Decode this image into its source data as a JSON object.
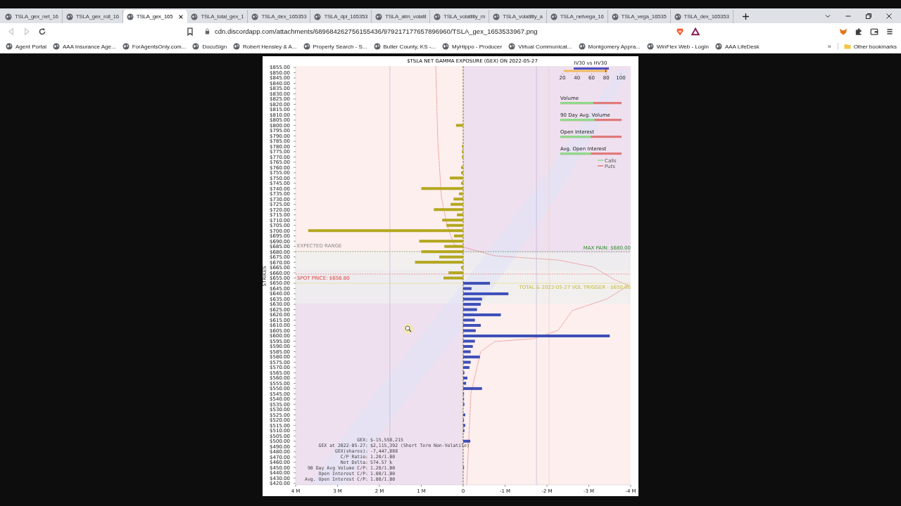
{
  "browser": {
    "tabs": [
      {
        "title": "TSLA_gex_net_16",
        "selected": false
      },
      {
        "title": "TSLA_gex_roll_16",
        "selected": false
      },
      {
        "title": "TSLA_gex_165",
        "selected": true
      },
      {
        "title": "TSLA_total_gex_1",
        "selected": false
      },
      {
        "title": "TSLA_dex_165353",
        "selected": false
      },
      {
        "title": "TSLA_dpi_165353",
        "selected": false
      },
      {
        "title": "TSLA_atm_volatil",
        "selected": false
      },
      {
        "title": "TSLA_volatility_m",
        "selected": false
      },
      {
        "title": "TSLA_volatility_a",
        "selected": false
      },
      {
        "title": "TSLA_netvega_16",
        "selected": false
      },
      {
        "title": "TSLA_vega_16535",
        "selected": false
      },
      {
        "title": "TSLA_dex_165353",
        "selected": false
      }
    ],
    "address": "cdn.discordapp.com/attachments/689684262756155436/979217177657896960/TSLA_gex_1653533967.png",
    "bookmarks": [
      "Agent Portal",
      "AAA Insurance Age...",
      "ForAgentsOnly.com...",
      "DocuSign",
      "Robert Hensley & A...",
      "Property Search - S...",
      "Butler County, KS -...",
      "MyHippo - Producer",
      "Virtual Communicat...",
      "Montgomery Appra...",
      "WinFlex Web - Login",
      "AAA LifeDesk"
    ],
    "bookmarks_more": "»",
    "other_bookmarks": "Other bookmarks"
  },
  "image": {
    "chart_data": {
      "type": "bar",
      "orientation": "horizontal",
      "title": "$TSLA NET GAMMA EXPOSURE (GEX) ON 2022-05-27",
      "ylabel": "STRIKES",
      "categories": [
        "$855.00",
        "$850.00",
        "$845.00",
        "$840.00",
        "$835.00",
        "$830.00",
        "$825.00",
        "$820.00",
        "$815.00",
        "$810.00",
        "$805.00",
        "$800.00",
        "$795.00",
        "$790.00",
        "$785.00",
        "$780.00",
        "$775.00",
        "$770.00",
        "$765.00",
        "$760.00",
        "$755.00",
        "$750.00",
        "$745.00",
        "$740.00",
        "$735.00",
        "$730.00",
        "$725.00",
        "$720.00",
        "$715.00",
        "$710.00",
        "$705.00",
        "$700.00",
        "$695.00",
        "$690.00",
        "$685.00",
        "$680.00",
        "$675.00",
        "$670.00",
        "$665.00",
        "$660.00",
        "$655.00",
        "$650.00",
        "$645.00",
        "$640.00",
        "$635.00",
        "$630.00",
        "$625.00",
        "$620.00",
        "$615.00",
        "$610.00",
        "$605.00",
        "$600.00",
        "$595.00",
        "$590.00",
        "$585.00",
        "$580.00",
        "$575.00",
        "$570.00",
        "$565.00",
        "$560.00",
        "$555.00",
        "$550.00",
        "$545.00",
        "$540.00",
        "$535.00",
        "$530.00",
        "$525.00",
        "$520.00",
        "$515.00",
        "$510.00",
        "$505.00",
        "$500.00",
        "$490.00",
        "$480.00",
        "$470.00",
        "$460.00",
        "$450.00",
        "$440.00",
        "$430.00",
        "$420.00"
      ],
      "values": [
        0,
        0,
        0,
        0,
        0,
        0,
        0,
        0,
        0,
        0,
        0,
        0.17,
        0,
        0,
        0,
        0.03,
        0.03,
        0.03,
        0,
        0.05,
        0.05,
        0.32,
        0.05,
        1.0,
        0.1,
        0.23,
        0.3,
        0.7,
        0.15,
        0.5,
        0.4,
        3.7,
        0.22,
        1.05,
        0.45,
        1.0,
        0.57,
        1.15,
        0.05,
        0.35,
        0.47,
        -0.64,
        -0.2,
        -1.08,
        -0.45,
        -0.42,
        -0.33,
        -0.9,
        -0.28,
        -0.42,
        -0.3,
        -3.5,
        -0.28,
        -0.23,
        -0.18,
        -0.4,
        -0.18,
        -0.15,
        -0.03,
        -0.1,
        -0.07,
        -0.45,
        -0.02,
        -0.02,
        -0.03,
        0,
        -0.05,
        -0.02,
        -0.05,
        -0.03,
        0,
        -0.17,
        0,
        0,
        0,
        0,
        -0.02,
        0,
        0,
        0
      ],
      "xlim": [
        4,
        -4
      ],
      "ref_lines": [
        {
          "axis": "x",
          "value": 1.75,
          "color": "#b9a9d4"
        },
        {
          "axis": "x",
          "value": -1.75,
          "color": "#b9a9d4"
        },
        {
          "axis": "x",
          "value": -2.05,
          "color": "#f2c4b4"
        }
      ],
      "xticks": [
        {
          "value": 4,
          "label": "4 M"
        },
        {
          "value": 3,
          "label": "3 M"
        },
        {
          "value": 2,
          "label": "2 M"
        },
        {
          "value": 1,
          "label": "1 M"
        },
        {
          "value": 0,
          "label": "0"
        },
        {
          "value": -1,
          "label": "-1 M"
        },
        {
          "value": -2,
          "label": "-2 M"
        },
        {
          "value": -3,
          "label": "-3 M"
        },
        {
          "value": -4,
          "label": "-4 M"
        }
      ]
    },
    "expected_range": {
      "label": "EXPECTED RANGE"
    },
    "max_pain": {
      "label": "MAX PAIN: $680.00"
    },
    "spot_price": {
      "label": "SPOT PRICE: $658.80"
    },
    "vol_trigger": {
      "label": "TOTAL & 2022-05-27 VOL TRIGGER - $650.00"
    },
    "stats": [
      {
        "label": "GEX:",
        "value": "$-15,558,215"
      },
      {
        "label": "GEX at 2022-05-27:",
        "value": "$2,115,392 (Short Term Non-Volatile)"
      },
      {
        "label": "GEX(shares):",
        "value": "-7,447,888"
      },
      {
        "label": "C/P Ratio:",
        "value": "1.20/1.00"
      },
      {
        "label": "Net Delta:",
        "value": "574.57 k"
      },
      {
        "label": "90 Day Avg Volume C/P:",
        "value": "1.20/1.00"
      },
      {
        "label": "Open Interest C/P:",
        "value": "1.00/1.00"
      },
      {
        "label": "Avg. Open Interest C/P:",
        "value": "1.00/1.00"
      }
    ],
    "iv_hv": {
      "title": "IV30 vs HV30",
      "ticks": [
        "20",
        "40",
        "60",
        "80",
        "100"
      ]
    },
    "ratios": [
      {
        "label": "Volume",
        "level": 0.54
      },
      {
        "label": "90 Day Avg. Volume",
        "level": 0.56
      },
      {
        "label": "Open Interest",
        "level": 0.5
      },
      {
        "label": "Avg. Open Interest",
        "level": 0.5
      }
    ],
    "legend": [
      "Calls",
      "Puts"
    ]
  }
}
